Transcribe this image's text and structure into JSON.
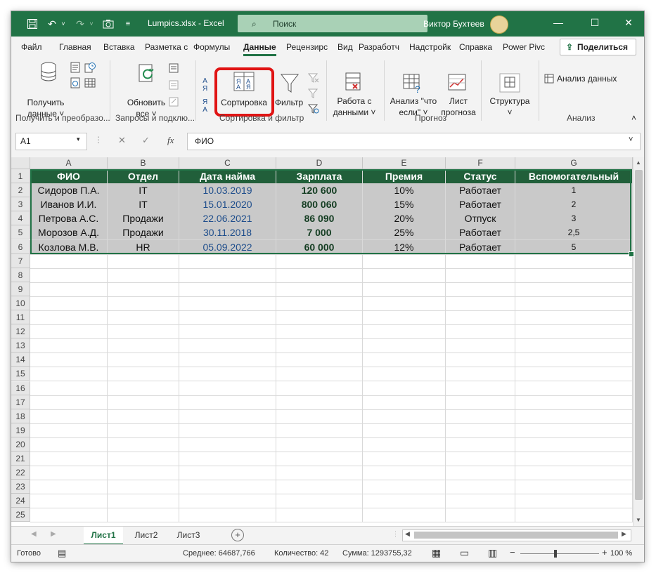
{
  "title_bar": {
    "file_name": "Lumpics.xlsx  -  Excel",
    "search_placeholder": "Поиск",
    "user_name": "Виктор Бухтеев"
  },
  "menu": {
    "tabs": [
      "Файл",
      "Главная",
      "Вставка",
      "Разметка с",
      "Формулы",
      "Данные",
      "Рецензирс",
      "Вид",
      "Разработч",
      "Надстройк",
      "Справка",
      "Power Pivc"
    ],
    "active_tab": "Данные",
    "share_label": "Поделиться"
  },
  "ribbon": {
    "get_data_label_1": "Получить",
    "get_data_label_2": "данные",
    "refresh_label_1": "Обновить",
    "refresh_label_2": "все",
    "sort_label": "Сортировка",
    "filter_label": "Фильтр",
    "data_tools_label_1": "Работа с",
    "data_tools_label_2": "данными",
    "whatif_label_1": "Анализ \"что",
    "whatif_label_2": "если\"",
    "forecast_label_1": "Лист",
    "forecast_label_2": "прогноза",
    "outline_label": "Структура",
    "analysis_label": "Анализ данных",
    "groups": {
      "get_transform": "Получить и преобразо...",
      "queries": "Запросы и подклю...",
      "sort_filter": "Сортировка и фильтр",
      "forecast": "Прогноз",
      "analysis": "Анализ"
    }
  },
  "formula_bar": {
    "name_box": "A1",
    "fx": "fx",
    "content": "ФИО"
  },
  "sheet": {
    "columns": [
      "A",
      "B",
      "C",
      "D",
      "E",
      "F",
      "G"
    ],
    "row_numbers": [
      "1",
      "2",
      "3",
      "4",
      "5",
      "6",
      "7",
      "8",
      "9",
      "10",
      "11",
      "12",
      "13",
      "14",
      "15",
      "16",
      "17",
      "18",
      "19",
      "20",
      "21",
      "22",
      "23",
      "24",
      "25"
    ],
    "header": [
      "ФИО",
      "Отдел",
      "Дата найма",
      "Зарплата",
      "Премия",
      "Статус",
      "Вспомогательный"
    ],
    "rows": [
      [
        "Сидоров П.А.",
        "IT",
        "10.03.2019",
        "120 600",
        "10%",
        "Работает",
        "1"
      ],
      [
        "Иванов И.И.",
        "IT",
        "15.01.2020",
        "800 060",
        "15%",
        "Работает",
        "2"
      ],
      [
        "Петрова А.С.",
        "Продажи",
        "22.06.2021",
        "86 090",
        "20%",
        "Отпуск",
        "3"
      ],
      [
        "Морозов А.Д.",
        "Продажи",
        "30.11.2018",
        "7 000",
        "25%",
        "Работает",
        "2,5"
      ],
      [
        "Козлова М.В.",
        "HR",
        "05.09.2022",
        "60 000",
        "12%",
        "Работает",
        "5"
      ]
    ]
  },
  "sheet_tabs": [
    "Лист1",
    "Лист2",
    "Лист3"
  ],
  "status_bar": {
    "ready": "Готово",
    "average": "Среднее: 64687,766",
    "count": "Количество: 42",
    "sum": "Сумма: 1293755,32",
    "zoom": "100 %"
  },
  "colors": {
    "accent": "#217346",
    "highlight": "#e01414"
  }
}
